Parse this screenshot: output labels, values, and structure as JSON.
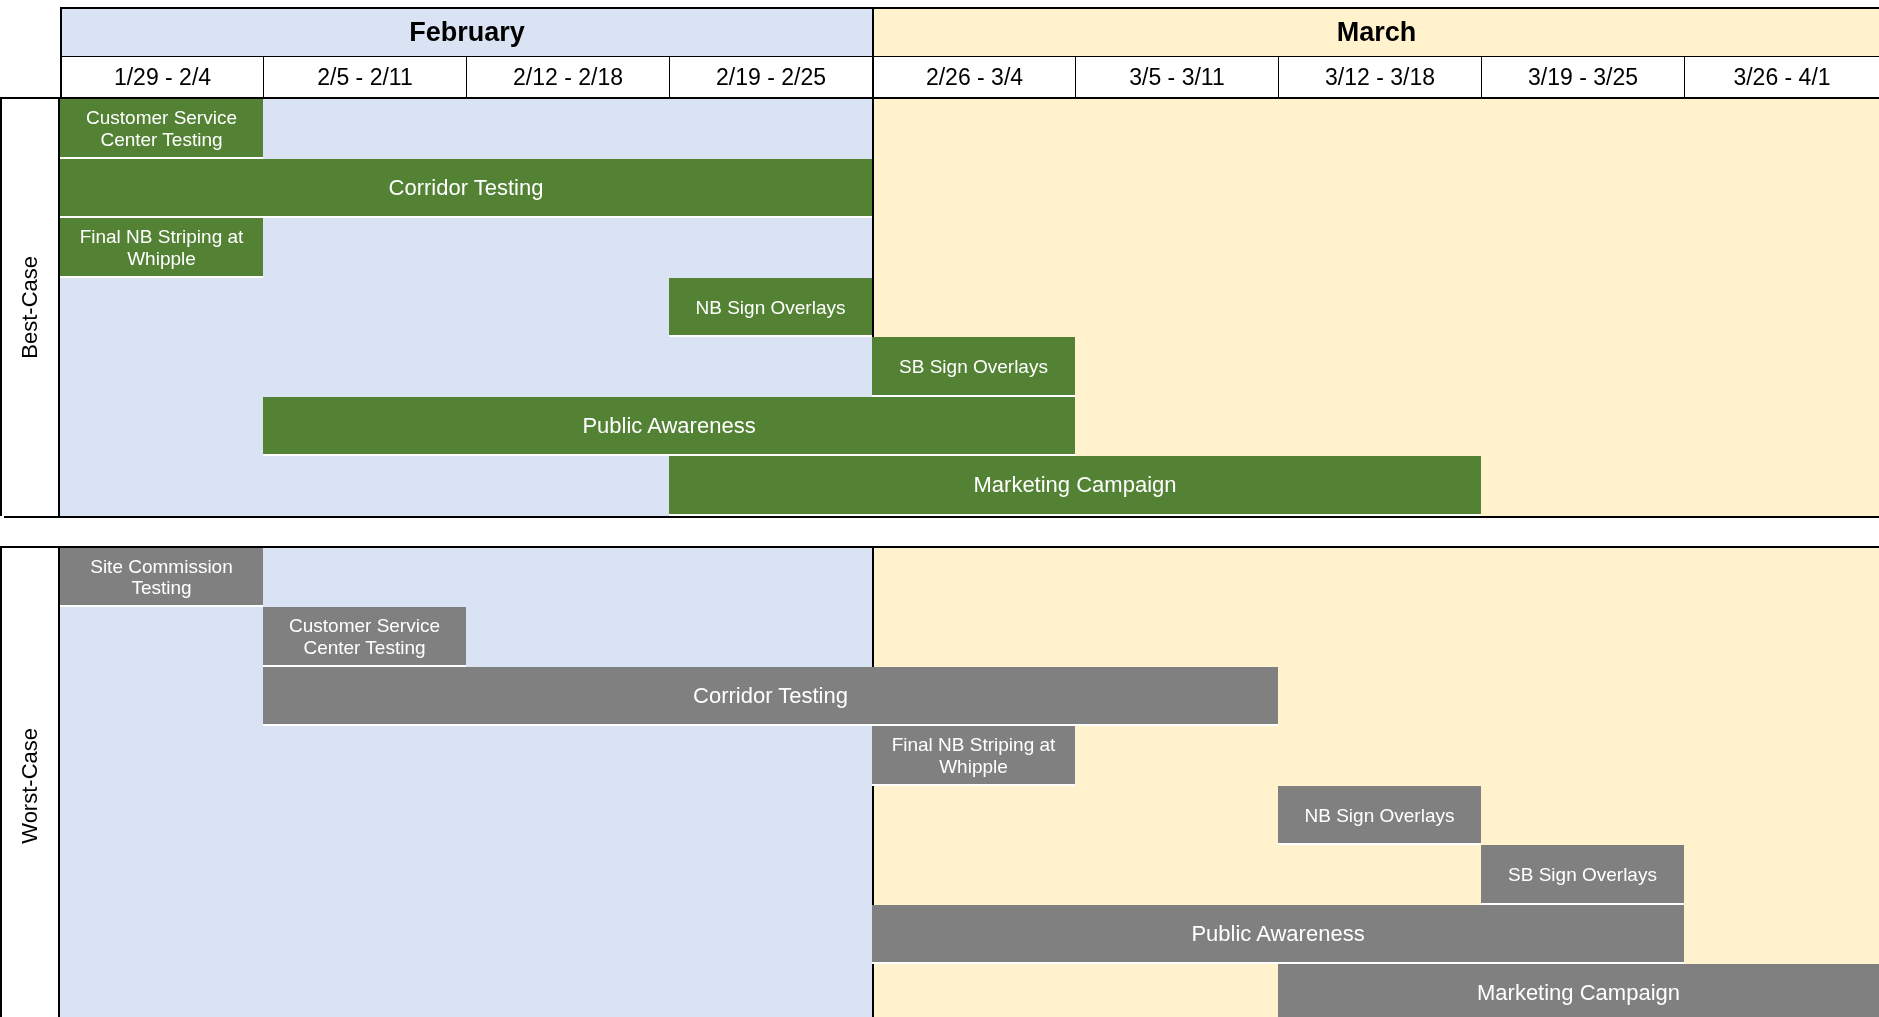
{
  "months": [
    {
      "label": "February",
      "color": "#dae3f3",
      "weeks": [
        "1/29 - 2/4",
        "2/5 - 2/11",
        "2/12 - 2/18",
        "2/19 - 2/25"
      ]
    },
    {
      "label": "March",
      "color": "#fff2cc",
      "weeks": [
        "2/26 - 3/4",
        "3/5 - 3/11",
        "3/12 - 3/18",
        "3/19 - 3/25",
        "3/26 - 4/1"
      ]
    }
  ],
  "sections": [
    {
      "label": "Best-Case",
      "color": "#548235",
      "tasks": [
        {
          "name": "Customer Service Center Testing",
          "weeks_on": [
            true,
            false,
            false,
            false,
            false,
            false,
            false,
            false,
            false
          ]
        },
        {
          "name": "Corridor Testing",
          "weeks_on": [
            true,
            true,
            true,
            true,
            false,
            false,
            false,
            false,
            false
          ]
        },
        {
          "name": "Final NB Striping at Whipple",
          "weeks_on": [
            true,
            false,
            false,
            false,
            false,
            false,
            false,
            false,
            false
          ]
        },
        {
          "name": "NB Sign Overlays",
          "weeks_on": [
            false,
            false,
            false,
            true,
            false,
            false,
            false,
            false,
            false
          ]
        },
        {
          "name": "SB Sign Overlays",
          "weeks_on": [
            false,
            false,
            false,
            false,
            true,
            false,
            false,
            false,
            false
          ]
        },
        {
          "name": "Public Awareness",
          "weeks_on": [
            false,
            true,
            true,
            true,
            true,
            false,
            false,
            false,
            false
          ]
        },
        {
          "name": "Marketing Campaign",
          "weeks_on": [
            false,
            false,
            false,
            true,
            true,
            true,
            true,
            false,
            false
          ]
        }
      ]
    },
    {
      "label": "Worst-Case",
      "color": "#808080",
      "tasks": [
        {
          "name": "Site Commission Testing",
          "weeks_on": [
            true,
            false,
            false,
            false,
            false,
            false,
            false,
            false,
            false
          ]
        },
        {
          "name": "Customer Service Center Testing",
          "weeks_on": [
            false,
            true,
            false,
            false,
            false,
            false,
            false,
            false,
            false
          ]
        },
        {
          "name": "Corridor Testing",
          "weeks_on": [
            false,
            true,
            true,
            true,
            true,
            true,
            false,
            false,
            false
          ]
        },
        {
          "name": "Final NB Striping at Whipple",
          "weeks_on": [
            false,
            false,
            false,
            false,
            true,
            false,
            false,
            false,
            false
          ]
        },
        {
          "name": "NB Sign Overlays",
          "weeks_on": [
            false,
            false,
            false,
            false,
            false,
            false,
            true,
            false,
            false
          ]
        },
        {
          "name": "SB Sign Overlays",
          "weeks_on": [
            false,
            false,
            false,
            false,
            false,
            false,
            false,
            true,
            false
          ]
        },
        {
          "name": "Public Awareness",
          "weeks_on": [
            false,
            false,
            false,
            false,
            true,
            true,
            true,
            true,
            false
          ]
        },
        {
          "name": "Marketing Campaign",
          "weeks_on": [
            false,
            false,
            false,
            false,
            false,
            false,
            true,
            true,
            true
          ]
        }
      ]
    }
  ]
}
